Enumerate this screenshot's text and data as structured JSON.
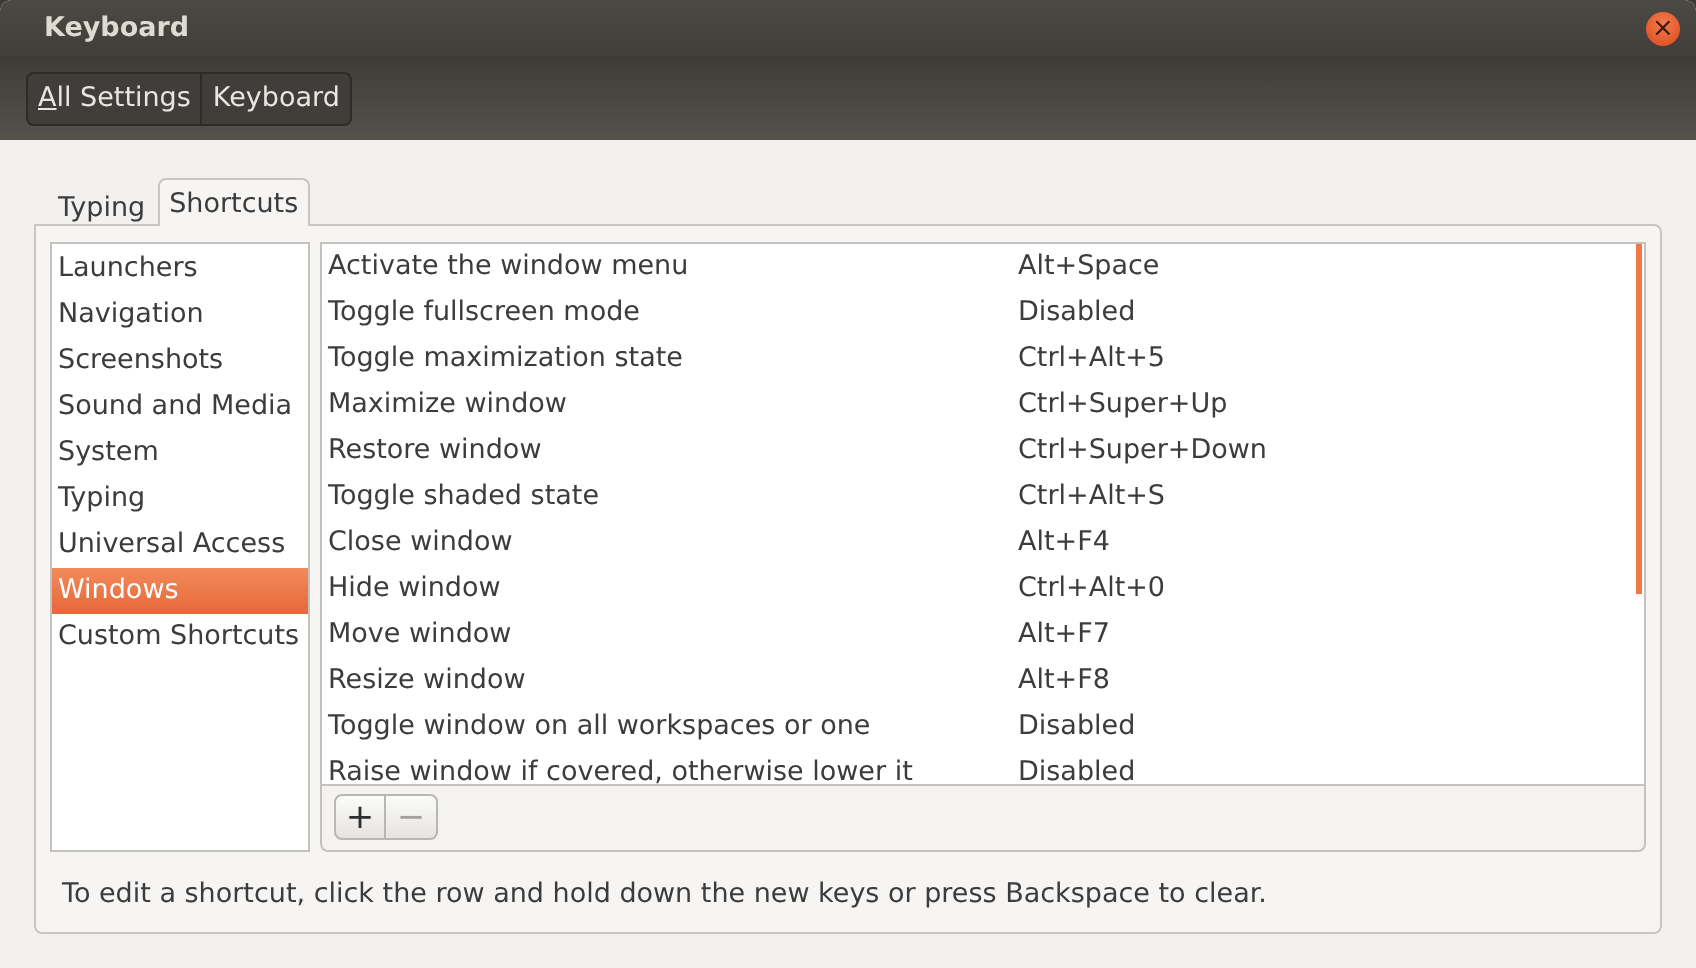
{
  "window": {
    "title": "Keyboard",
    "close": "×"
  },
  "breadcrumbs": [
    {
      "label": "All Settings",
      "mnemonic": true
    },
    {
      "label": "Keyboard",
      "mnemonic": false
    }
  ],
  "tabs": [
    {
      "label": "Typing",
      "selected": false
    },
    {
      "label": "Shortcuts",
      "selected": true
    }
  ],
  "categories": [
    {
      "label": "Launchers",
      "selected": false
    },
    {
      "label": "Navigation",
      "selected": false
    },
    {
      "label": "Screenshots",
      "selected": false
    },
    {
      "label": "Sound and Media",
      "selected": false
    },
    {
      "label": "System",
      "selected": false
    },
    {
      "label": "Typing",
      "selected": false
    },
    {
      "label": "Universal Access",
      "selected": false
    },
    {
      "label": "Windows",
      "selected": true
    },
    {
      "label": "Custom Shortcuts",
      "selected": false
    }
  ],
  "shortcuts": [
    {
      "action": "Activate the window menu",
      "keys": "Alt+Space"
    },
    {
      "action": "Toggle fullscreen mode",
      "keys": "Disabled"
    },
    {
      "action": "Toggle maximization state",
      "keys": "Ctrl+Alt+5"
    },
    {
      "action": "Maximize window",
      "keys": "Ctrl+Super+Up"
    },
    {
      "action": "Restore window",
      "keys": "Ctrl+Super+Down"
    },
    {
      "action": "Toggle shaded state",
      "keys": "Ctrl+Alt+S"
    },
    {
      "action": "Close window",
      "keys": "Alt+F4"
    },
    {
      "action": "Hide window",
      "keys": "Ctrl+Alt+0"
    },
    {
      "action": "Move window",
      "keys": "Alt+F7"
    },
    {
      "action": "Resize window",
      "keys": "Alt+F8"
    },
    {
      "action": "Toggle window on all workspaces or one",
      "keys": "Disabled"
    },
    {
      "action": "Raise window if covered, otherwise lower it",
      "keys": "Disabled"
    }
  ],
  "list_buttons": [
    {
      "label": "+",
      "disabled": false
    },
    {
      "label": "−",
      "disabled": true
    }
  ],
  "hint": "To edit a shortcut, click the row and hold down the new keys or press Backspace to clear."
}
